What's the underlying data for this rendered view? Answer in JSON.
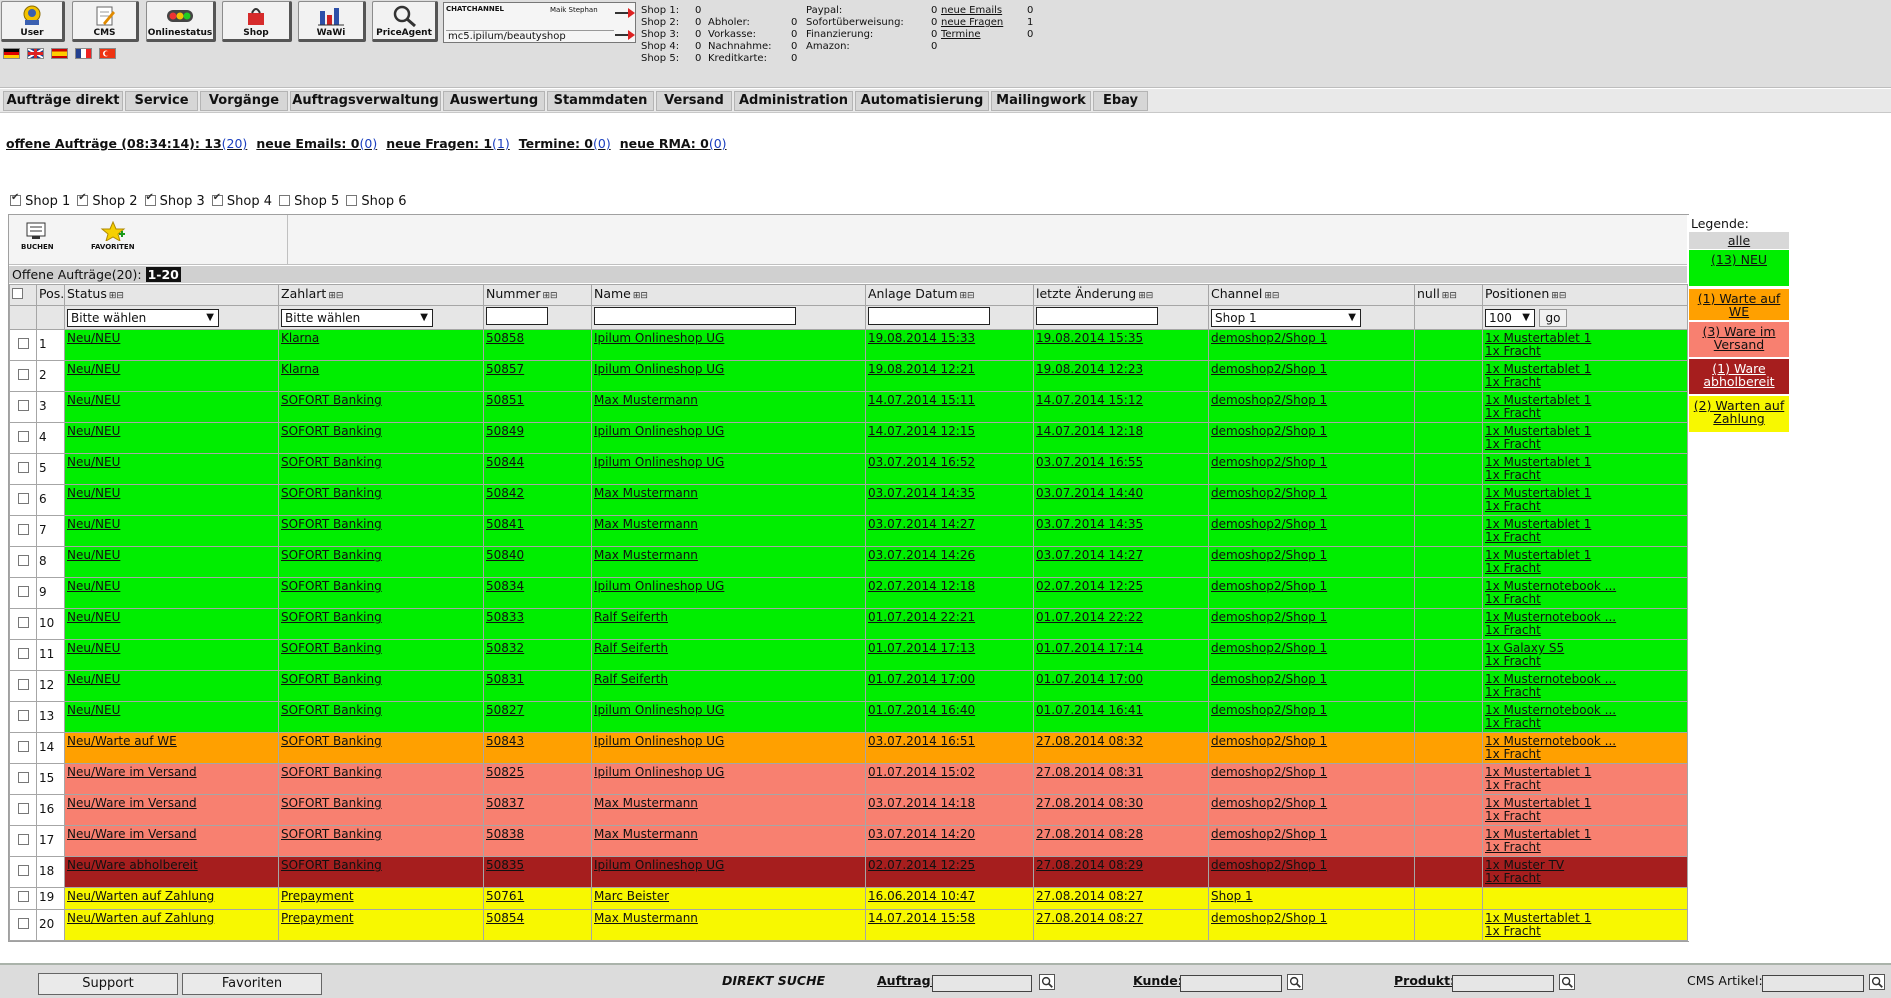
{
  "toolbar": {
    "buttons": [
      {
        "label": "User",
        "icon": "user-icon"
      },
      {
        "label": "CMS",
        "icon": "cms-icon"
      },
      {
        "label": "Onlinestatus",
        "icon": "onlinestatus-icon"
      },
      {
        "label": "Shop",
        "icon": "shop-icon"
      },
      {
        "label": "WaWi",
        "icon": "wawi-icon"
      },
      {
        "label": "PriceAgent",
        "icon": "priceagent-icon"
      }
    ],
    "flags": [
      "flag-de",
      "flag-gb",
      "flag-es",
      "flag-fr",
      "flag-tr"
    ],
    "chat": {
      "title": "CHATCHANNEL",
      "user": "Maik Stephan",
      "url": "mc5.ipilum/beautyshop"
    }
  },
  "shop_stats": {
    "col1": [
      {
        "label": "Shop 1:",
        "value": "0"
      },
      {
        "label": "Shop 2:",
        "value": "0"
      },
      {
        "label": "Shop 3:",
        "value": "0"
      },
      {
        "label": "Shop 4:",
        "value": "0"
      },
      {
        "label": "Shop 5:",
        "value": "0"
      }
    ],
    "col2": [
      {
        "label": "Abholer:",
        "value": "0"
      },
      {
        "label": "Vorkasse:",
        "value": "0"
      },
      {
        "label": "Nachnahme:",
        "value": "0"
      },
      {
        "label": "Kreditkarte:",
        "value": "0"
      }
    ],
    "col3": [
      {
        "label": "Paypal:",
        "value": "0"
      },
      {
        "label": "Sofortüberweisung:",
        "value": "0"
      },
      {
        "label": "Finanzierung:",
        "value": "0"
      },
      {
        "label": "Amazon:",
        "value": "0"
      }
    ],
    "col4": [
      {
        "label": "neue Emails",
        "value": "0"
      },
      {
        "label": "neue Fragen",
        "value": "1"
      },
      {
        "label": "Termine",
        "value": "0"
      }
    ]
  },
  "menu": [
    "Aufträge direkt",
    "Service",
    "Vorgänge",
    "Auftragsverwaltung",
    "Auswertung",
    "Stammdaten",
    "Versand",
    "Administration",
    "Automatisierung",
    "Mailingwork",
    "Ebay"
  ],
  "status_line": [
    {
      "label": "offene Aufträge (08:34:14): 13",
      "count": "(20)"
    },
    {
      "label": "neue Emails: 0",
      "count": "(0)"
    },
    {
      "label": "neue Fragen: 1",
      "count": "(1)"
    },
    {
      "label": "Termine: 0",
      "count": "(0)"
    },
    {
      "label": "neue RMA: 0",
      "count": "(0)"
    }
  ],
  "shops": [
    {
      "label": "Shop 1",
      "checked": true
    },
    {
      "label": "Shop 2",
      "checked": true
    },
    {
      "label": "Shop 3",
      "checked": true
    },
    {
      "label": "Shop 4",
      "checked": true
    },
    {
      "label": "Shop 5",
      "checked": false
    },
    {
      "label": "Shop 6",
      "checked": false
    }
  ],
  "actions": {
    "book": "BUCHEN",
    "favorite": "FAVORITEN"
  },
  "orders_header": {
    "label": "Offene Aufträge(20):",
    "range": "1-20"
  },
  "columns": [
    "Pos.",
    "Status",
    "Zahlart",
    "Nummer",
    "Name",
    "Anlage Datum",
    "letzte Änderung",
    "Channel",
    "null",
    "Positionen"
  ],
  "filters": {
    "status": "Bitte wählen",
    "zahlart": "Bitte wählen",
    "channel": "Shop 1",
    "perpage": "100",
    "go": "go"
  },
  "rows": [
    {
      "pos": "1",
      "status": "Neu/NEU",
      "zahlart": "Klarna",
      "nummer": "50858",
      "name": "Ipilum Onlineshop UG",
      "anlage": "19.08.2014 15:33",
      "aenderung": "19.08.2014 15:35",
      "channel": "demoshop2/Shop 1",
      "null": "",
      "pos1": "1x Mustertablet 1",
      "pos2": "1x Fracht",
      "color": "neu"
    },
    {
      "pos": "2",
      "status": "Neu/NEU",
      "zahlart": "Klarna",
      "nummer": "50857",
      "name": "Ipilum Onlineshop UG",
      "anlage": "19.08.2014 12:21",
      "aenderung": "19.08.2014 12:23",
      "channel": "demoshop2/Shop 1",
      "null": "",
      "pos1": "1x Mustertablet 1",
      "pos2": "1x Fracht",
      "color": "neu"
    },
    {
      "pos": "3",
      "status": "Neu/NEU",
      "zahlart": "SOFORT Banking",
      "nummer": "50851",
      "name": "Max Mustermann",
      "anlage": "14.07.2014 15:11",
      "aenderung": "14.07.2014 15:12",
      "channel": "demoshop2/Shop 1",
      "null": "",
      "pos1": "1x Mustertablet 1",
      "pos2": "1x Fracht",
      "color": "neu"
    },
    {
      "pos": "4",
      "status": "Neu/NEU",
      "zahlart": "SOFORT Banking",
      "nummer": "50849",
      "name": "Ipilum Onlineshop UG",
      "anlage": "14.07.2014 12:15",
      "aenderung": "14.07.2014 12:18",
      "channel": "demoshop2/Shop 1",
      "null": "",
      "pos1": "1x Mustertablet 1",
      "pos2": "1x Fracht",
      "color": "neu"
    },
    {
      "pos": "5",
      "status": "Neu/NEU",
      "zahlart": "SOFORT Banking",
      "nummer": "50844",
      "name": "Ipilum Onlineshop UG",
      "anlage": "03.07.2014 16:52",
      "aenderung": "03.07.2014 16:55",
      "channel": "demoshop2/Shop 1",
      "null": "",
      "pos1": "1x Mustertablet 1",
      "pos2": "1x Fracht",
      "color": "neu"
    },
    {
      "pos": "6",
      "status": "Neu/NEU",
      "zahlart": "SOFORT Banking",
      "nummer": "50842",
      "name": "Max Mustermann",
      "anlage": "03.07.2014 14:35",
      "aenderung": "03.07.2014 14:40",
      "channel": "demoshop2/Shop 1",
      "null": "",
      "pos1": "1x Mustertablet 1",
      "pos2": "1x Fracht",
      "color": "neu"
    },
    {
      "pos": "7",
      "status": "Neu/NEU",
      "zahlart": "SOFORT Banking",
      "nummer": "50841",
      "name": "Max Mustermann",
      "anlage": "03.07.2014 14:27",
      "aenderung": "03.07.2014 14:35",
      "channel": "demoshop2/Shop 1",
      "null": "",
      "pos1": "1x Mustertablet 1",
      "pos2": "1x Fracht",
      "color": "neu"
    },
    {
      "pos": "8",
      "status": "Neu/NEU",
      "zahlart": "SOFORT Banking",
      "nummer": "50840",
      "name": "Max Mustermann",
      "anlage": "03.07.2014 14:26",
      "aenderung": "03.07.2014 14:27",
      "channel": "demoshop2/Shop 1",
      "null": "",
      "pos1": "1x Mustertablet 1",
      "pos2": "1x Fracht",
      "color": "neu"
    },
    {
      "pos": "9",
      "status": "Neu/NEU",
      "zahlart": "SOFORT Banking",
      "nummer": "50834",
      "name": "Ipilum Onlineshop UG",
      "anlage": "02.07.2014 12:18",
      "aenderung": "02.07.2014 12:25",
      "channel": "demoshop2/Shop 1",
      "null": "",
      "pos1": "1x Musternotebook ...",
      "pos2": "1x Fracht",
      "color": "neu"
    },
    {
      "pos": "10",
      "status": "Neu/NEU",
      "zahlart": "SOFORT Banking",
      "nummer": "50833",
      "name": "Ralf Seiferth",
      "anlage": "01.07.2014 22:21",
      "aenderung": "01.07.2014 22:22",
      "channel": "demoshop2/Shop 1",
      "null": "",
      "pos1": "1x Musternotebook ...",
      "pos2": "1x Fracht",
      "color": "neu"
    },
    {
      "pos": "11",
      "status": "Neu/NEU",
      "zahlart": "SOFORT Banking",
      "nummer": "50832",
      "name": "Ralf Seiferth",
      "anlage": "01.07.2014 17:13",
      "aenderung": "01.07.2014 17:14",
      "channel": "demoshop2/Shop 1",
      "null": "",
      "pos1": "1x Galaxy S5",
      "pos2": "1x Fracht",
      "color": "neu"
    },
    {
      "pos": "12",
      "status": "Neu/NEU",
      "zahlart": "SOFORT Banking",
      "nummer": "50831",
      "name": "Ralf Seiferth",
      "anlage": "01.07.2014 17:00",
      "aenderung": "01.07.2014 17:00",
      "channel": "demoshop2/Shop 1",
      "null": "",
      "pos1": "1x Musternotebook ...",
      "pos2": "1x Fracht",
      "color": "neu"
    },
    {
      "pos": "13",
      "status": "Neu/NEU",
      "zahlart": "SOFORT Banking",
      "nummer": "50827",
      "name": "Ipilum Onlineshop UG",
      "anlage": "01.07.2014 16:40",
      "aenderung": "01.07.2014 16:41",
      "channel": "demoshop2/Shop 1",
      "null": "",
      "pos1": "1x Musternotebook ...",
      "pos2": "1x Fracht",
      "color": "neu"
    },
    {
      "pos": "14",
      "status": "Neu/Warte auf WE",
      "zahlart": "SOFORT Banking",
      "nummer": "50843",
      "name": "Ipilum Onlineshop UG",
      "anlage": "03.07.2014 16:51",
      "aenderung": "27.08.2014 08:32",
      "channel": "demoshop2/Shop 1",
      "null": "",
      "pos1": "1x Musternotebook ...",
      "pos2": "1x Fracht",
      "color": "we"
    },
    {
      "pos": "15",
      "status": "Neu/Ware im Versand",
      "zahlart": "SOFORT Banking",
      "nummer": "50825",
      "name": "Ipilum Onlineshop UG",
      "anlage": "01.07.2014 15:02",
      "aenderung": "27.08.2014 08:31",
      "channel": "demoshop2/Shop 1",
      "null": "",
      "pos1": "1x Mustertablet 1",
      "pos2": "1x Fracht",
      "color": "vers"
    },
    {
      "pos": "16",
      "status": "Neu/Ware im Versand",
      "zahlart": "SOFORT Banking",
      "nummer": "50837",
      "name": "Max Mustermann",
      "anlage": "03.07.2014 14:18",
      "aenderung": "27.08.2014 08:30",
      "channel": "demoshop2/Shop 1",
      "null": "",
      "pos1": "1x Mustertablet 1",
      "pos2": "1x Fracht",
      "color": "vers"
    },
    {
      "pos": "17",
      "status": "Neu/Ware im Versand",
      "zahlart": "SOFORT Banking",
      "nummer": "50838",
      "name": "Max Mustermann",
      "anlage": "03.07.2014 14:20",
      "aenderung": "27.08.2014 08:28",
      "channel": "demoshop2/Shop 1",
      "null": "",
      "pos1": "1x Mustertablet 1",
      "pos2": "1x Fracht",
      "color": "vers"
    },
    {
      "pos": "18",
      "status": "Neu/Ware abholbereit",
      "zahlart": "SOFORT Banking",
      "nummer": "50835",
      "name": "Ipilum Onlineshop UG",
      "anlage": "02.07.2014 12:25",
      "aenderung": "27.08.2014 08:29",
      "channel": "demoshop2/Shop 1",
      "null": "",
      "pos1": "1x Muster TV",
      "pos2": "1x Fracht",
      "color": "abh"
    },
    {
      "pos": "19",
      "status": "Neu/Warten auf Zahlung",
      "zahlart": "Prepayment",
      "nummer": "50761",
      "name": "Marc Beister",
      "anlage": "16.06.2014 10:47",
      "aenderung": "27.08.2014 08:27",
      "channel": "Shop 1",
      "null": "",
      "pos1": "",
      "pos2": "",
      "color": "zahl"
    },
    {
      "pos": "20",
      "status": "Neu/Warten auf Zahlung",
      "zahlart": "Prepayment",
      "nummer": "50854",
      "name": "Max Mustermann",
      "anlage": "14.07.2014 15:58",
      "aenderung": "27.08.2014 08:27",
      "channel": "demoshop2/Shop 1",
      "null": "",
      "pos1": "1x Mustertablet 1",
      "pos2": "1x Fracht",
      "color": "zahl"
    }
  ],
  "legend": {
    "title": "Legende:",
    "items": [
      {
        "label": "alle",
        "color": "#d8d8d8"
      },
      {
        "label": "(13) NEU",
        "color": "#00ee00"
      },
      {
        "label": "(1) Warte auf WE",
        "color": "#ffa000"
      },
      {
        "label": "(3) Ware im Versand",
        "color": "#f88070"
      },
      {
        "label": "(1) Ware abholbereit",
        "color": "#a61e1e"
      },
      {
        "label": "(2) Warten auf Zahlung",
        "color": "#f8f800"
      }
    ]
  },
  "footer": {
    "support": "Support",
    "favoriten": "Favoriten",
    "direkt": "DIREKT SUCHE",
    "auftrag": "Auftrag:",
    "kunde": "Kunde:",
    "produkt": "Produkt:",
    "cms": "CMS Artikel:"
  }
}
